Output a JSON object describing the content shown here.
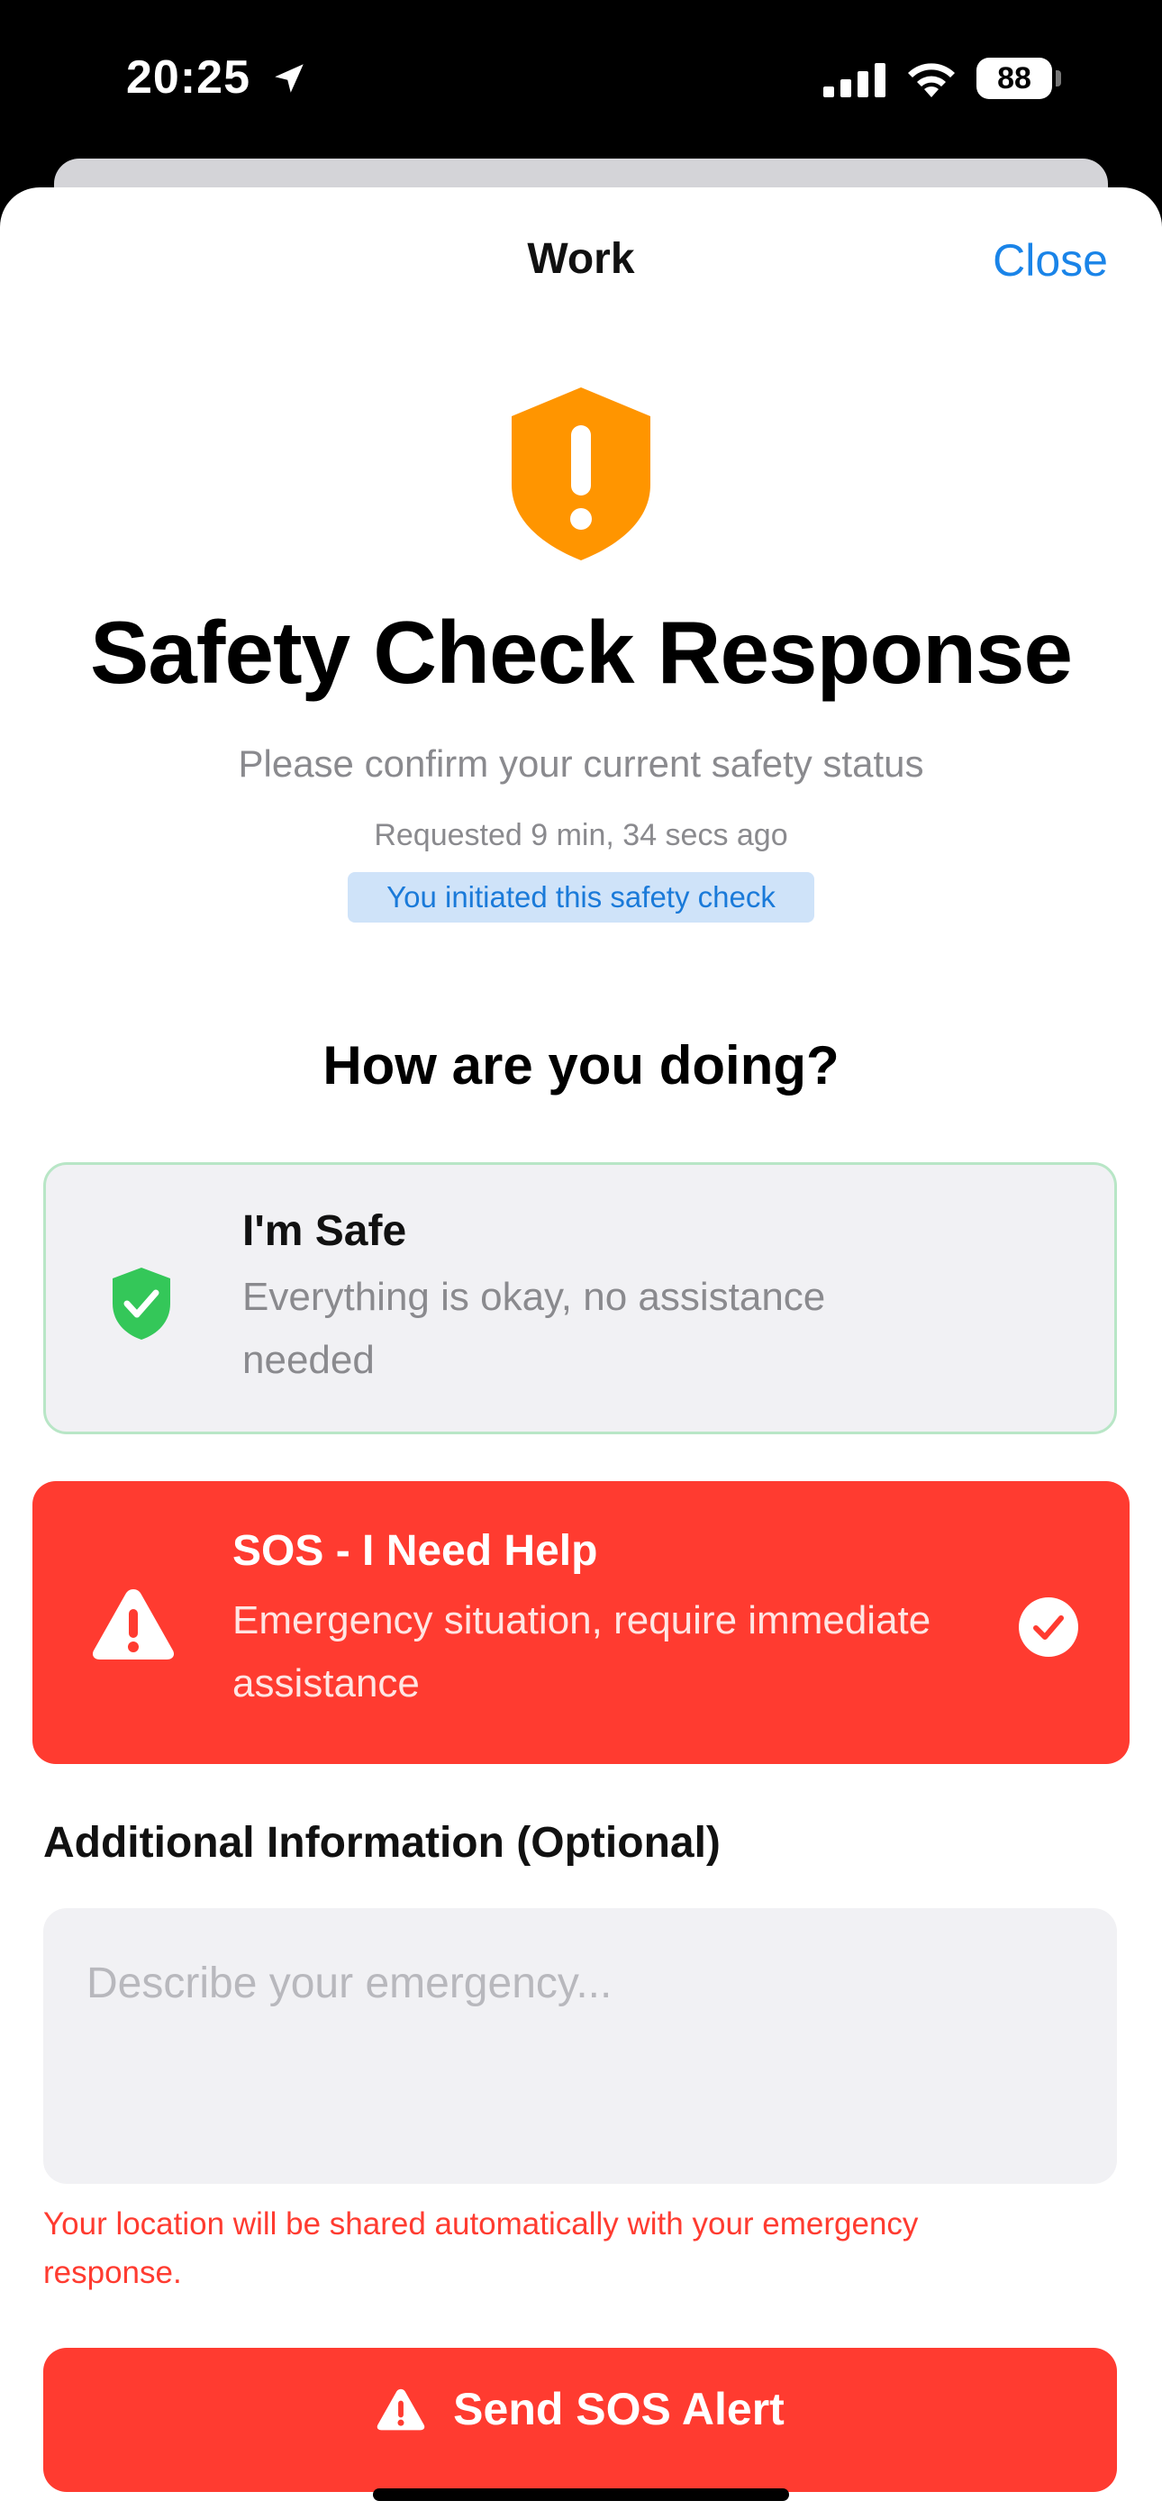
{
  "status_bar": {
    "time": "20:25",
    "battery": "88"
  },
  "nav": {
    "title": "Work",
    "close_label": "Close"
  },
  "header": {
    "title": "Safety Check Response",
    "subtitle": "Please confirm your current safety status",
    "requested": "Requested 9 min, 34 secs ago",
    "initiated_badge": "You initiated this safety check"
  },
  "question": "How are you doing?",
  "options": [
    {
      "title": "I'm Safe",
      "description": "Everything is okay, no assistance needed",
      "icon": "shield-check-icon",
      "selected": false
    },
    {
      "title": "SOS - I Need Help",
      "description": "Emergency situation, require immediate assistance",
      "icon": "warning-triangle-icon",
      "selected": true
    }
  ],
  "additional": {
    "label": "Additional Information (Optional)",
    "placeholder": "Describe your emergency...",
    "value": ""
  },
  "location_note": "Your location will be shared automatically with your emergency response.",
  "send_button": {
    "label": "Send SOS Alert",
    "icon": "warning-triangle-icon"
  },
  "colors": {
    "accent_blue": "#1a84e8",
    "sos_red": "#ff3b30",
    "safe_green": "#34c759",
    "warning_orange": "#ff9500"
  }
}
